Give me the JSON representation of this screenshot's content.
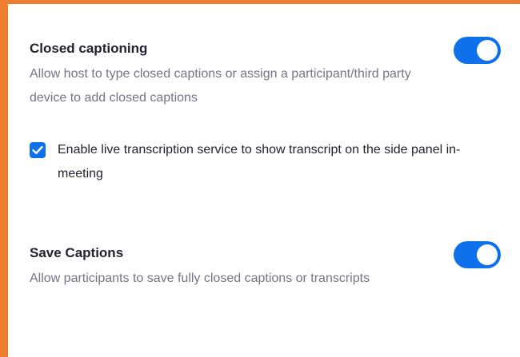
{
  "closed_captioning": {
    "title": "Closed captioning",
    "description": "Allow host to type closed captions or assign a participant/third party device to add closed captions",
    "toggle_on": true,
    "live_transcription": {
      "label": "Enable live transcription service to show transcript on the side panel in-meeting",
      "checked": true
    }
  },
  "save_captions": {
    "title": "Save Captions",
    "description": "Allow participants to save fully closed captions or transcripts",
    "toggle_on": true
  },
  "colors": {
    "accent": "#0e71eb",
    "frame_border": "#ee7d30",
    "title_text": "#23232e",
    "description_text": "#747487"
  }
}
